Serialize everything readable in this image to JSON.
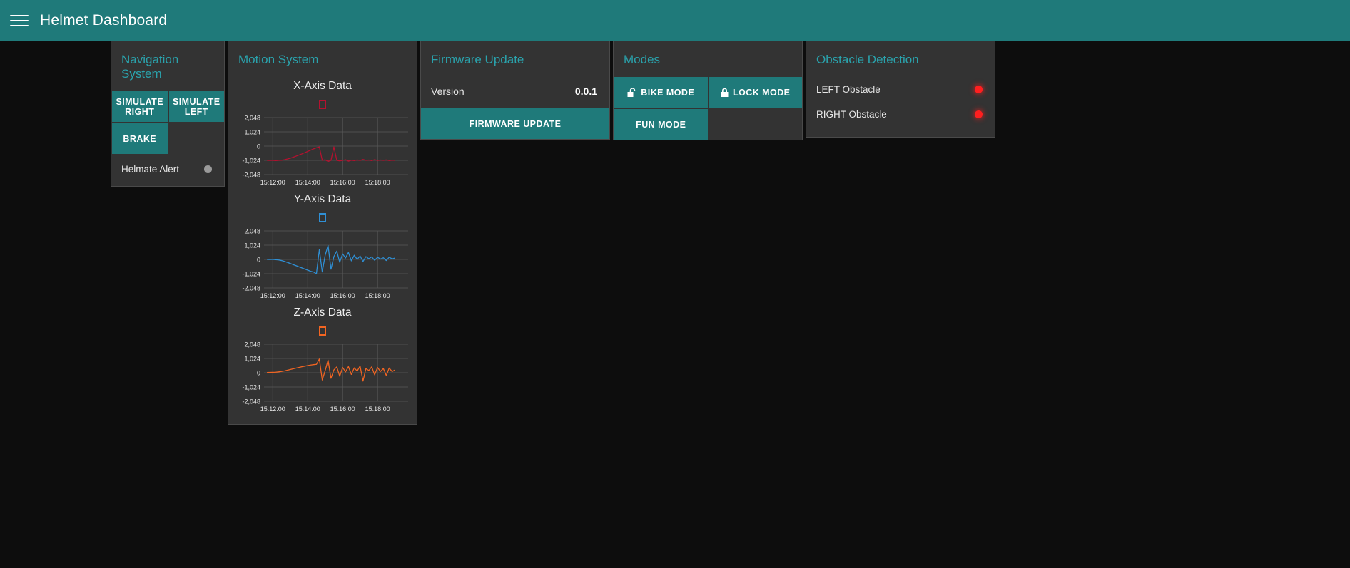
{
  "appbar": {
    "menu_icon": "hamburger-menu-icon",
    "title": "Helmet Dashboard",
    "background": "#1F7A7A"
  },
  "theme": {
    "accent": "#1F7A7A",
    "card_title": "#2aa3ad",
    "card_bg": "#333333",
    "page_bg": "#0d0d0d",
    "led_idle": "#9a9a9a",
    "led_alert": "#ff1f1f"
  },
  "navigation": {
    "title": "Navigation System",
    "buttons": [
      {
        "label": "SIMULATE RIGHT"
      },
      {
        "label": "SIMULATE LEFT"
      },
      {
        "label": "BRAKE"
      }
    ],
    "status": {
      "label": "Helmate Alert",
      "state": "inactive",
      "color": "#9a9a9a"
    }
  },
  "motion": {
    "title": "Motion System"
  },
  "firmware": {
    "title": "Firmware Update",
    "version_label": "Version",
    "version_value": "0.0.1",
    "update_button": "FIRMWARE UPDATE"
  },
  "modes": {
    "title": "Modes",
    "buttons": [
      {
        "label": "BIKE MODE",
        "icon": "unlock-icon"
      },
      {
        "label": "LOCK MODE",
        "icon": "lock-icon"
      },
      {
        "label": "FUN MODE",
        "icon": "none"
      }
    ]
  },
  "obstacle": {
    "title": "Obstacle Detection",
    "rows": [
      {
        "label": "LEFT Obstacle",
        "state": "detected",
        "color": "#ff1f1f"
      },
      {
        "label": "RIGHT Obstacle",
        "state": "detected",
        "color": "#ff1f1f"
      }
    ]
  },
  "chart_data": [
    {
      "type": "line",
      "title": "X-Axis Data",
      "color": "#b5112f",
      "legend": [
        "X-Axis Data"
      ],
      "legend_position": "top-center",
      "grid": true,
      "xlabel": "",
      "ylabel": "",
      "ylim": [
        -2048,
        2048
      ],
      "yticks": [
        2048,
        1024,
        0,
        -1024,
        -2048
      ],
      "ytick_labels": [
        "2,048",
        "1,024",
        "0",
        "-1,024",
        "-2,048"
      ],
      "xticks": [
        "15:12:00",
        "15:14:00",
        "15:16:00",
        "15:18:00"
      ],
      "x": [
        15.2,
        15.4,
        15.6,
        15.8,
        16.0,
        16.2,
        16.4,
        16.6,
        16.8,
        17.0,
        17.2,
        17.4,
        17.6,
        17.8,
        18.0,
        18.2,
        18.4,
        18.6,
        18.8,
        19.0,
        19.2,
        19.4,
        19.6,
        19.8,
        20.0,
        20.2,
        20.4,
        20.6,
        20.8,
        21.0,
        21.2,
        21.4,
        21.6,
        21.8,
        22.0,
        22.2,
        22.4,
        22.6,
        22.8,
        23.0,
        23.2,
        23.4,
        23.6,
        23.8,
        24.0
      ],
      "values": [
        -1024,
        -1030,
        -1024,
        -1040,
        -1024,
        -1015,
        -980,
        -930,
        -870,
        -800,
        -720,
        -640,
        -560,
        -470,
        -380,
        -290,
        -200,
        -120,
        -60,
        -1024,
        -980,
        -1100,
        -1024,
        -60,
        -1024,
        -1060,
        -1024,
        -980,
        -1080,
        -1010,
        -1040,
        -990,
        -1030,
        -960,
        -1020,
        -1000,
        -1040,
        -970,
        -1030,
        -1000,
        -1020,
        -990,
        -1035,
        -1010,
        -1024
      ]
    },
    {
      "type": "line",
      "title": "Y-Axis Data",
      "color": "#2f8fd4",
      "legend": [
        "Y-Axis Data"
      ],
      "legend_position": "top-center",
      "grid": true,
      "xlabel": "",
      "ylabel": "",
      "ylim": [
        -2048,
        2048
      ],
      "yticks": [
        2048,
        1024,
        0,
        -1024,
        -2048
      ],
      "ytick_labels": [
        "2,048",
        "1,024",
        "0",
        "-1,024",
        "-2,048"
      ],
      "xticks": [
        "15:12:00",
        "15:14:00",
        "15:16:00",
        "15:18:00"
      ],
      "x": [
        15.2,
        15.4,
        15.6,
        15.8,
        16.0,
        16.2,
        16.4,
        16.6,
        16.8,
        17.0,
        17.2,
        17.4,
        17.6,
        17.8,
        18.0,
        18.2,
        18.4,
        18.6,
        18.8,
        19.0,
        19.2,
        19.4,
        19.6,
        19.8,
        20.0,
        20.2,
        20.4,
        20.6,
        20.8,
        21.0,
        21.2,
        21.4,
        21.6,
        21.8,
        22.0,
        22.2,
        22.4,
        22.6,
        22.8,
        23.0,
        23.2,
        23.4,
        23.6,
        23.8,
        24.0
      ],
      "values": [
        0,
        -5,
        0,
        -20,
        -40,
        -80,
        -140,
        -210,
        -290,
        -370,
        -450,
        -530,
        -610,
        -690,
        -770,
        -850,
        -900,
        -1024,
        700,
        -900,
        300,
        1000,
        -700,
        200,
        600,
        -200,
        400,
        100,
        500,
        -100,
        300,
        0,
        250,
        -150,
        200,
        50,
        180,
        -60,
        150,
        30,
        120,
        -80,
        160,
        40,
        100
      ]
    },
    {
      "type": "line",
      "title": "Z-Axis Data",
      "color": "#f26522",
      "legend": [
        "Z-Axis Data"
      ],
      "legend_position": "top-center",
      "grid": true,
      "xlabel": "",
      "ylabel": "",
      "ylim": [
        -2048,
        2048
      ],
      "yticks": [
        2048,
        1024,
        0,
        -1024,
        -2048
      ],
      "ytick_labels": [
        "2,048",
        "1,024",
        "0",
        "-1,024",
        "-2,048"
      ],
      "xticks": [
        "15:12:00",
        "15:14:00",
        "15:16:00",
        "15:18:00"
      ],
      "x": [
        15.2,
        15.4,
        15.6,
        15.8,
        16.0,
        16.2,
        16.4,
        16.6,
        16.8,
        17.0,
        17.2,
        17.4,
        17.6,
        17.8,
        18.0,
        18.2,
        18.4,
        18.6,
        18.8,
        19.0,
        19.2,
        19.4,
        19.6,
        19.8,
        20.0,
        20.2,
        20.4,
        20.6,
        20.8,
        21.0,
        21.2,
        21.4,
        21.6,
        21.8,
        22.0,
        22.2,
        22.4,
        22.6,
        22.8,
        23.0,
        23.2,
        23.4,
        23.6,
        23.8,
        24.0
      ],
      "values": [
        20,
        25,
        30,
        40,
        60,
        90,
        130,
        180,
        230,
        280,
        330,
        380,
        430,
        470,
        510,
        550,
        580,
        600,
        980,
        -520,
        150,
        900,
        -400,
        200,
        420,
        -250,
        380,
        60,
        440,
        -120,
        350,
        120,
        480,
        -600,
        300,
        160,
        420,
        -150,
        380,
        90,
        300,
        -200,
        340,
        80,
        200
      ]
    }
  ]
}
